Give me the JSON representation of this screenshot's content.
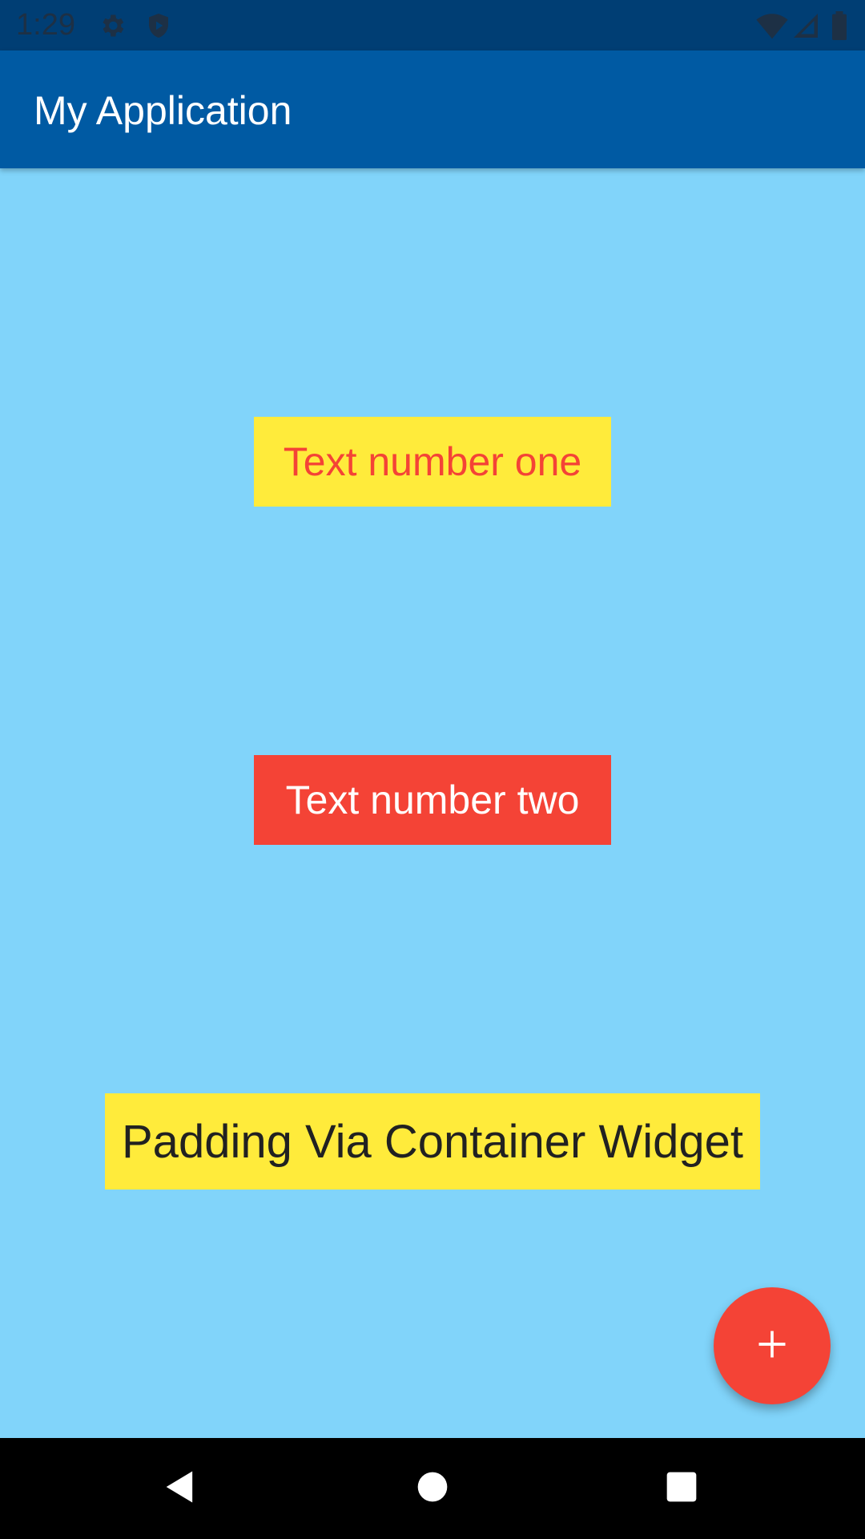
{
  "status_bar": {
    "time": "1:29",
    "icons": [
      "gear-icon",
      "shield-icon",
      "wifi-icon",
      "signal-icon",
      "battery-icon"
    ]
  },
  "app_bar": {
    "title": "My Application"
  },
  "body": {
    "text_one": "Text number one",
    "text_two": "Text number two",
    "text_three": "Padding Via Container Widget"
  },
  "fab": {
    "icon": "plus-icon"
  },
  "nav_bar": {
    "icons": [
      "back-icon",
      "home-icon",
      "recents-icon"
    ]
  },
  "colors": {
    "background": "#81d4fa",
    "app_bar": "#005aa3",
    "status_bar": "#003e74",
    "yellow": "#ffeb3b",
    "red": "#f44336"
  }
}
